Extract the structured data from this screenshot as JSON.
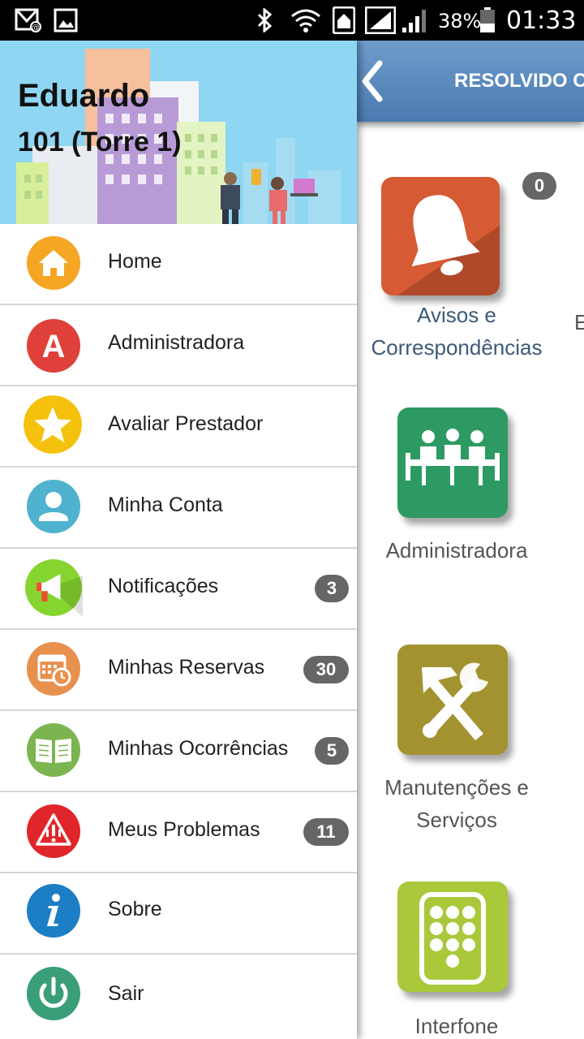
{
  "status_bar": {
    "battery_percent": "38%",
    "time": "01:33",
    "icons": [
      "email-icon",
      "image-icon",
      "bluetooth-icon",
      "wifi-icon",
      "home-icon",
      "signal-icon",
      "signal-icon",
      "battery-icon"
    ]
  },
  "drawer": {
    "user_name": "Eduardo",
    "unit": "101 (Torre 1)",
    "items": [
      {
        "label": "Home",
        "icon": "home-icon",
        "color": "#f5a623"
      },
      {
        "label": "Administradora",
        "icon": "letter-a-icon",
        "color": "#e0403a"
      },
      {
        "label": "Avaliar Prestador",
        "icon": "star-icon",
        "color": "#f4c20d"
      },
      {
        "label": "Minha Conta",
        "icon": "user-icon",
        "color": "#4fb3cf"
      },
      {
        "label": "Notificações",
        "icon": "megaphone-icon",
        "color": "#86d42f",
        "badge": "3"
      },
      {
        "label": "Minhas Reservas",
        "icon": "calendar-icon",
        "color": "#e8914f",
        "badge": "30"
      },
      {
        "label": "Minhas Ocorrências",
        "icon": "book-icon",
        "color": "#7cb550",
        "badge": "5"
      },
      {
        "label": "Meus Problemas",
        "icon": "warning-icon",
        "color": "#e0262a",
        "badge": "11"
      },
      {
        "label": "Sobre",
        "icon": "info-icon",
        "color": "#1c7ec4"
      },
      {
        "label": "Sair",
        "icon": "power-icon",
        "color": "#3a9e79"
      }
    ]
  },
  "main": {
    "title": "RESOLVIDO C",
    "back_icon": "chevron-left-icon",
    "tiles": [
      {
        "label": [
          "Avisos e",
          "Correspondências"
        ],
        "icon": "bell-icon",
        "color": "#d65a34",
        "badge": "0"
      },
      {
        "label": [
          "Administradora"
        ],
        "icon": "meeting-icon",
        "color": "#2e9a63"
      },
      {
        "label": [
          "Manutenções e",
          "Serviços"
        ],
        "icon": "tools-icon",
        "color": "#a39330"
      },
      {
        "label": [
          "Interfone"
        ],
        "icon": "keypad-icon",
        "color": "#a9c93a"
      }
    ],
    "partial_next_letter": "E"
  }
}
